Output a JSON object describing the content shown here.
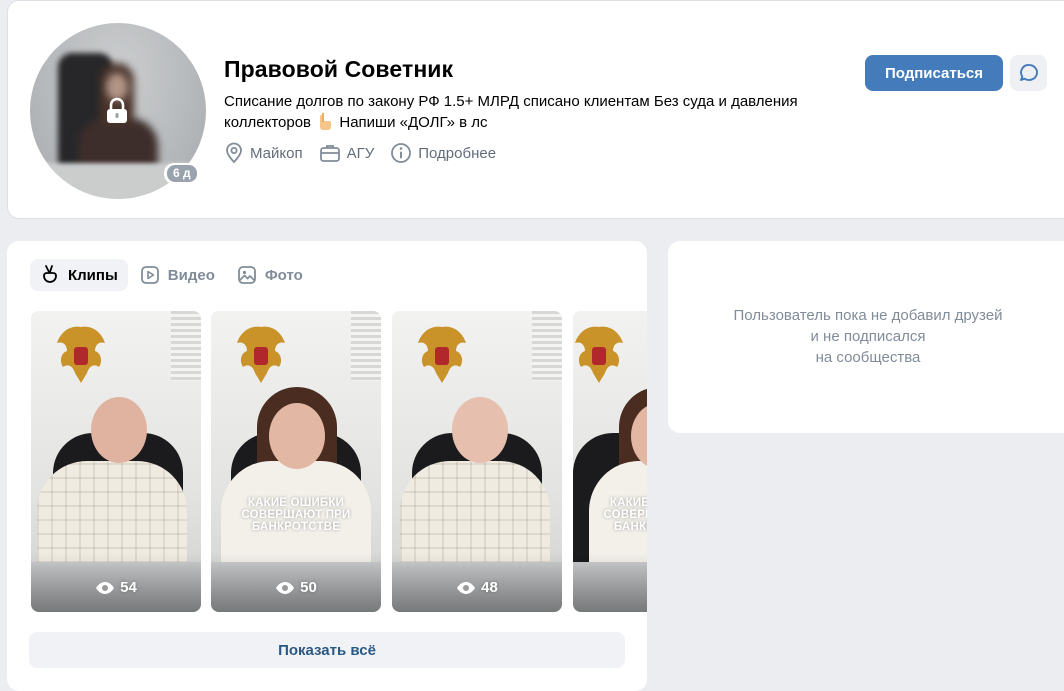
{
  "profile": {
    "name": "Правовой Советник",
    "status_text": "Списание долгов по закону РФ 1.5+ МЛРД списано клиентам Без суда и давления коллекторов",
    "status_emoji": "hand-pointing-right",
    "status_tail": "Напиши «ДОЛГ» в лс",
    "last_seen_badge": "6 д",
    "avatar_locked": true,
    "meta": {
      "city": "Майкоп",
      "university": "АГУ",
      "details": "Подробнее"
    },
    "subscribe_label": "Подписаться",
    "accent_color": "#447bba"
  },
  "media": {
    "tabs": [
      {
        "label": "Клипы",
        "icon": "clips-icon",
        "active": true
      },
      {
        "label": "Видео",
        "icon": "video-icon",
        "active": false
      },
      {
        "label": "Фото",
        "icon": "photo-icon",
        "active": false
      }
    ],
    "clips": [
      {
        "views": "54",
        "caption": ""
      },
      {
        "views": "50",
        "caption": "КАКИЕ ОШИБКИ СОВЕРШАЮТ ПРИ БАНКРОТСТВЕ"
      },
      {
        "views": "48",
        "caption": ""
      },
      {
        "views": "",
        "caption": "КАКИЕ ОШИБКИ СОВЕРШАЮТ ПРИ БАНКРОТСТВЕ"
      }
    ],
    "show_all_label": "Показать всё"
  },
  "friends": {
    "empty_line1": "Пользователь пока не добавил друзей",
    "empty_line2": "и не подписался",
    "empty_line3": "на сообщества"
  }
}
